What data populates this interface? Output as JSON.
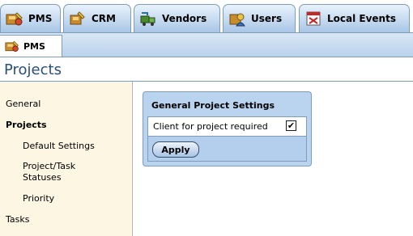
{
  "tabs": [
    {
      "label": "PMS",
      "icon": "pms-icon"
    },
    {
      "label": "CRM",
      "icon": "crm-icon"
    },
    {
      "label": "Vendors",
      "icon": "vendors-icon"
    },
    {
      "label": "Users",
      "icon": "users-icon"
    },
    {
      "label": "Local Events",
      "icon": "local-events-icon"
    }
  ],
  "subbar": {
    "label": "PMS",
    "icon": "pms-icon"
  },
  "page": {
    "title": "Projects"
  },
  "leftnav": {
    "items": [
      {
        "label": "General"
      },
      {
        "label": "Projects"
      },
      {
        "label": "Default Settings"
      },
      {
        "label": "Project/Task Statuses"
      },
      {
        "label": "Priority"
      },
      {
        "label": "Tasks"
      }
    ]
  },
  "panel": {
    "title": "General Project Settings",
    "row_label": "Client for project required",
    "checked": true,
    "checkmark": "✔",
    "apply_label": "Apply"
  },
  "colors": {
    "tab_blue": "#a8c6e6",
    "nav_bg": "#fdf6e3",
    "panel_bg": "#bad3ef",
    "title_color": "#2b4d7a"
  }
}
